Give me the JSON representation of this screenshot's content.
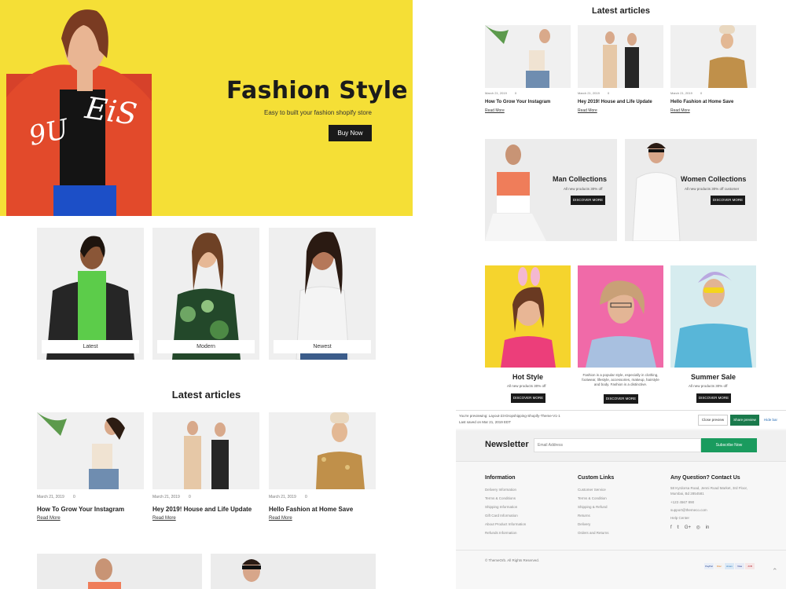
{
  "hero": {
    "title": "Fashion Style",
    "subtitle": "Easy to built your fashion shopify store",
    "button": "Buy Now"
  },
  "categories": [
    {
      "label": "Latest"
    },
    {
      "label": "Modern"
    },
    {
      "label": "Newest"
    }
  ],
  "articles_heading": "Latest articles",
  "articles": [
    {
      "date": "March 21, 2019",
      "comments": "0",
      "title": "How To Grow Your Instagram",
      "read": "Read More"
    },
    {
      "date": "March 21, 2019",
      "comments": "0",
      "title": "Hey 2019! House and Life Update",
      "read": "Read More"
    },
    {
      "date": "March 21, 2019",
      "comments": "0",
      "title": "Hello Fashion at Home Save",
      "read": "Read More"
    }
  ],
  "collections": [
    {
      "name": "Man Collections",
      "sub": "All new products 30% off",
      "button": "DISCOVER MORE"
    },
    {
      "name": "Women Collections",
      "sub": "All new products 30% off customer",
      "button": "DISCOVER MORE"
    }
  ],
  "promos": [
    {
      "name": "Hot Style",
      "sub": "All new products 30% off",
      "button": "DISCOVER MORE"
    },
    {
      "text": "Fashion is a popular style, especially in clothing, footwear, lifestyle, accessories, makeup, hairstyle and body. Fashion is a distinctive.",
      "button": "DISCOVER MORE"
    },
    {
      "name": "Summer Sale",
      "sub": "All new products 30% off",
      "button": "DISCOVER MORE"
    }
  ],
  "preview": {
    "line1": "You're previewing: Layout-23-Dropshipping-Shopify-Theme-V1-1",
    "line2": "Last saved on Mar 21, 2019 EDT",
    "close": "Close preview",
    "share": "Share preview",
    "hide": "Hide bar"
  },
  "newsletter": {
    "title": "Newsletter",
    "placeholder": "Email Address",
    "button": "Subscribe Now"
  },
  "footer": {
    "info_title": "Information",
    "info_links": [
      "Delivery Information",
      "Terms & Conditions",
      "Shipping Information",
      "Gift Card Information",
      "About Product Information",
      "Refunds Information"
    ],
    "custom_title": "Custom Links",
    "custom_links": [
      "Customer Service",
      "Terms & Condition",
      "Shipping & Refund",
      "Returns",
      "Delivery",
      "Orders and Returns"
    ],
    "contact_title": "Any Question? Contact Us",
    "contact_lines": [
      "58 Kyrdorsa Road, Jenni Road Market, 3rd Floor,",
      "Mumbai, Bd 2854581",
      "+123 4567 890",
      "support@themeco.com",
      "Help Center"
    ],
    "social_icons": [
      "f",
      "𝕥",
      "G+",
      "◎",
      "in"
    ],
    "copyright": "© ThemeOrb. All Rights Reserved.",
    "payments": [
      "PayPal",
      "Disc",
      "Amex",
      "Visa",
      "JCB"
    ]
  },
  "colors": {
    "hero_bg": "#f5df36",
    "accent_green": "#1a9b5e",
    "dark": "#1a1a1a"
  }
}
